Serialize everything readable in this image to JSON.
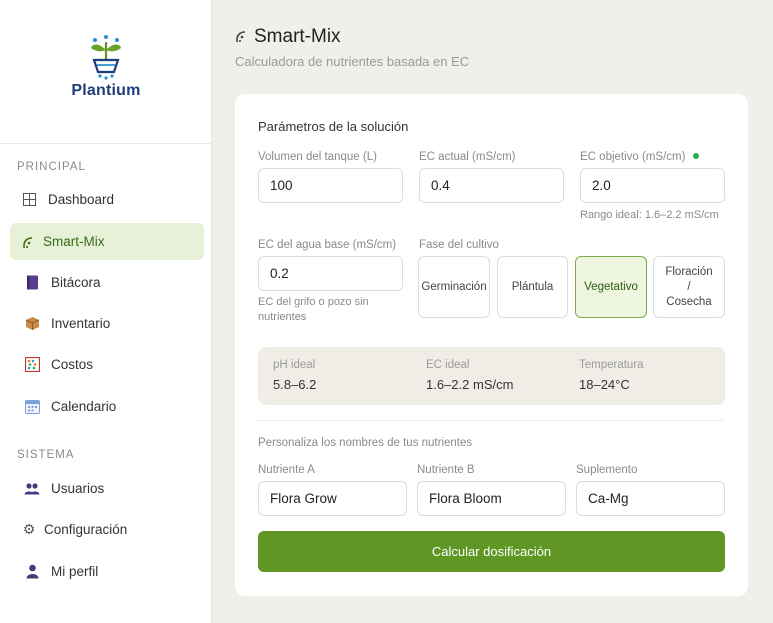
{
  "brand": {
    "name": "Plantium",
    "colors": {
      "primary_green": "#5f9624",
      "navy": "#1f3d7a",
      "accent_blue": "#2a8fd6"
    }
  },
  "sidebar": {
    "sections": [
      {
        "label": "PRINCIPAL",
        "items": [
          {
            "label": "Dashboard",
            "icon": "grid-icon",
            "active": false
          },
          {
            "label": "Smart-Mix",
            "icon": "flask-icon",
            "active": true
          },
          {
            "label": "Bitácora",
            "icon": "book-icon",
            "active": false
          },
          {
            "label": "Inventario",
            "icon": "package-icon",
            "active": false
          },
          {
            "label": "Costos",
            "icon": "abacus-icon",
            "active": false
          },
          {
            "label": "Calendario",
            "icon": "calendar-icon",
            "active": false
          }
        ]
      },
      {
        "label": "SISTEMA",
        "items": [
          {
            "label": "Usuarios",
            "icon": "users-icon",
            "active": false
          },
          {
            "label": "Configuración",
            "icon": "gear-icon",
            "active": false
          },
          {
            "label": "Mi perfil",
            "icon": "user-icon",
            "active": false
          }
        ]
      }
    ]
  },
  "header": {
    "title": "Smart-Mix",
    "subtitle": "Calculadora de nutrientes basada en EC"
  },
  "form": {
    "section_title": "Parámetros de la solución",
    "tank_volume": {
      "label": "Volumen del tanque (L)",
      "value": "100"
    },
    "ec_current": {
      "label": "EC actual (mS/cm)",
      "value": "0.4"
    },
    "ec_target": {
      "label": "EC objetivo (mS/cm)",
      "value": "2.0",
      "hint": "Rango ideal: 1.6–2.2 mS/cm"
    },
    "ec_base_water": {
      "label": "EC del agua base (mS/cm)",
      "value": "0.2",
      "hint": "EC del grifo o pozo sin nutrientes"
    },
    "phase": {
      "label": "Fase del cultivo",
      "options": [
        "Germinación",
        "Plántula",
        "Vegetativo",
        "Floración / Cosecha"
      ],
      "selected": "Vegetativo"
    },
    "ideal": {
      "ph": {
        "label": "pH ideal",
        "value": "5.8–6.2"
      },
      "ec": {
        "label": "EC ideal",
        "value": "1.6–2.2 mS/cm"
      },
      "temp": {
        "label": "Temperatura",
        "value": "18–24°C"
      }
    },
    "nutrients": {
      "title": "Personaliza los nombres de tus nutrientes",
      "a": {
        "label": "Nutriente A",
        "value": "Flora Grow"
      },
      "b": {
        "label": "Nutriente B",
        "value": "Flora Bloom"
      },
      "supplement": {
        "label": "Suplemento",
        "value": "Ca-Mg"
      }
    },
    "submit_label": "Calcular dosificación"
  }
}
